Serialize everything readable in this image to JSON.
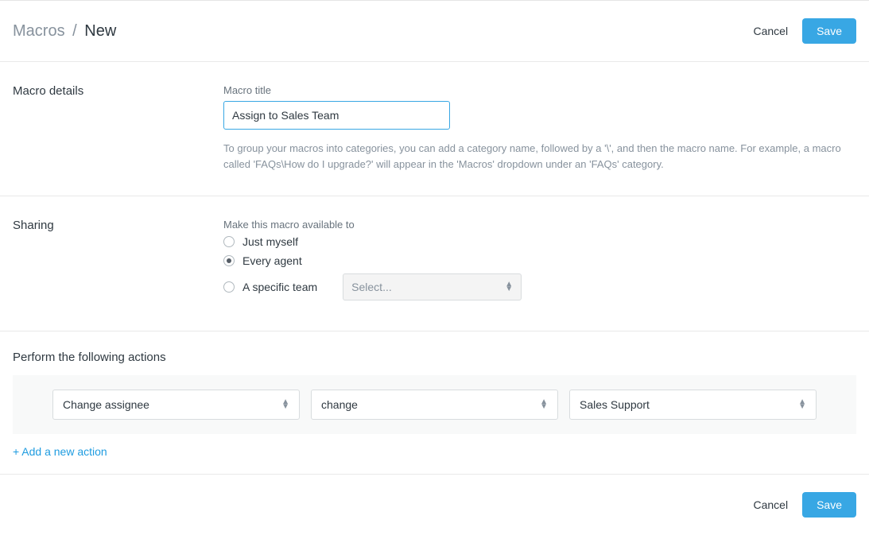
{
  "header": {
    "breadcrumb_parent": "Macros",
    "breadcrumb_sep": "/",
    "breadcrumb_current": "New",
    "cancel_label": "Cancel",
    "save_label": "Save"
  },
  "details": {
    "section_label": "Macro details",
    "title_label": "Macro title",
    "title_value": "Assign to Sales Team",
    "help_text": "To group your macros into categories, you can add a category name, followed by a '\\', and then the macro name. For example, a macro called 'FAQs\\How do I upgrade?' will appear in the 'Macros' dropdown under an 'FAQs' category."
  },
  "sharing": {
    "section_label": "Sharing",
    "field_label": "Make this macro available to",
    "options": {
      "myself": "Just myself",
      "every_agent": "Every agent",
      "specific_team": "A specific team"
    },
    "team_select_placeholder": "Select..."
  },
  "actions": {
    "title": "Perform the following actions",
    "row": {
      "field": "Change assignee",
      "operator": "change",
      "value": "Sales Support"
    },
    "add_label": "+ Add a new action"
  },
  "footer": {
    "cancel_label": "Cancel",
    "save_label": "Save"
  }
}
